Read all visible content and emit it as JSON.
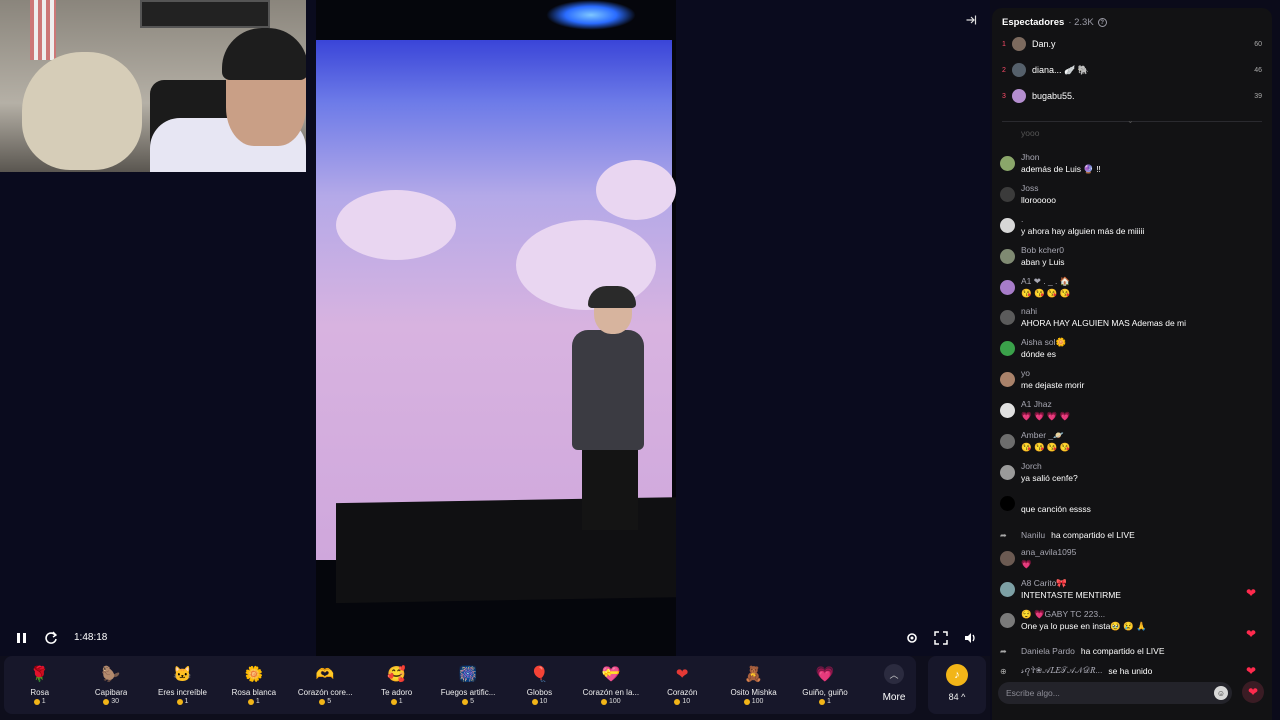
{
  "playback": {
    "time": "1:48:18"
  },
  "gifts": [
    {
      "name": "Rosa",
      "price": "1",
      "icon": "rose-icon",
      "glyph": "🌹",
      "color": "#d81b60"
    },
    {
      "name": "Capibara",
      "price": "30",
      "icon": "capybara-icon",
      "glyph": "🦫",
      "color": "#b5723a"
    },
    {
      "name": "Eres increíble",
      "price": "1",
      "icon": "cat-icon",
      "glyph": "🐱",
      "color": "#f2c27b"
    },
    {
      "name": "Rosa blanca",
      "price": "1",
      "icon": "white-rose-icon",
      "glyph": "🌼",
      "color": "#f5f2e8"
    },
    {
      "name": "Corazón core...",
      "price": "5",
      "icon": "heart-hand-icon",
      "glyph": "🫶",
      "color": "#f4a57c"
    },
    {
      "name": "Te adoro",
      "price": "1",
      "icon": "heart-face-icon",
      "glyph": "🥰",
      "color": "#e53935"
    },
    {
      "name": "Fuegos artific...",
      "price": "5",
      "icon": "fireworks-icon",
      "glyph": "🎆",
      "color": "#7e57c2"
    },
    {
      "name": "Globos",
      "price": "10",
      "icon": "balloons-icon",
      "glyph": "🎈",
      "color": "#90caf9"
    },
    {
      "name": "Corazón en la...",
      "price": "100",
      "icon": "heart-box-icon",
      "glyph": "💝",
      "color": "#f06292"
    },
    {
      "name": "Corazón",
      "price": "10",
      "icon": "heart-icon",
      "glyph": "❤",
      "color": "#e53935"
    },
    {
      "name": "Osito Mishka",
      "price": "100",
      "icon": "bear-icon",
      "glyph": "🧸",
      "color": "#8d5a3b"
    },
    {
      "name": "Guiño, guiño",
      "price": "1",
      "icon": "wink-heart-icon",
      "glyph": "💗",
      "color": "#f48fb1"
    }
  ],
  "gift_more": {
    "label": "More"
  },
  "balance": {
    "value": "84 ^",
    "glyph": "♪"
  },
  "viewers": {
    "title": "Espectadores",
    "count": "· 2.3K",
    "top": [
      {
        "rank": "1",
        "name": "Dan.y",
        "score": "60",
        "avatar_color": "#7c6a5e"
      },
      {
        "rank": "2",
        "name": "diana... 🪽 🐘",
        "score": "46",
        "avatar_color": "#55606b"
      },
      {
        "rank": "3",
        "name": "bugabu55.",
        "score": "39",
        "avatar_color": "#b48ecf"
      }
    ]
  },
  "chat": {
    "faded_name": "yooo",
    "messages": [
      {
        "name": "Jhon",
        "text": "además de Luis 🔮 ‼",
        "avatar_color": "#8aa66a"
      },
      {
        "name": "Joss",
        "text": "llorooooo",
        "avatar_color": "#3b3b3b"
      },
      {
        "name": ".",
        "text": "y ahora hay alguien más de miiiii",
        "avatar_color": "#d7d7d7"
      },
      {
        "name": "Bob kcher0",
        "text": "aban y Luis",
        "avatar_color": "#7f8a72"
      },
      {
        "name": "A1 ❤ . _ . 🏠",
        "text": "😘 😘 😘 😘",
        "avatar_color": "#a77cc9"
      },
      {
        "name": "nahi",
        "text": "AHORA HAY ALGUIEN MAS Ademas de mi",
        "avatar_color": "#5b5b5b"
      },
      {
        "name": "Aisha sol🌼",
        "text": "dónde es",
        "avatar_color": "#3aa14a"
      },
      {
        "name": "yo",
        "text": "me dejaste morir",
        "avatar_color": "#a9826a"
      },
      {
        "name": "A1 Jhaz",
        "text": "💗 💗 💗 💗",
        "avatar_color": "#e0e0e0"
      },
      {
        "name": "Amber _🪐",
        "text": "😘 😘 😘 😘",
        "avatar_color": "#6d6d6d"
      },
      {
        "name": "Jorch",
        "text": "ya salió cenfe?",
        "avatar_color": "#9a9a9a"
      },
      {
        "name": "",
        "text": "que canción essss",
        "avatar_color": "#000000"
      }
    ],
    "system_1": {
      "name": "Nanilu",
      "text": "ha compartido el LIVE"
    },
    "messages_2": [
      {
        "name": "ana_avila1095",
        "text": "💗",
        "avatar_color": "#6b5a52"
      },
      {
        "name": "A8 Carito🎀",
        "text": "INTENTASTE MENTIRME",
        "avatar_color": "#7da0a5"
      },
      {
        "name": "😌 💗GABY TC 223...",
        "text": "One ya lo puse en insta🥹 😢 🙏",
        "avatar_color": "#7a7a7a"
      }
    ],
    "system_2": {
      "name": "Daniela Pardo",
      "text": "ha compartido el LIVE"
    },
    "system_3": {
      "name": "𝓈ꪖ✞❀𝒜𝐿𝐸𝒯𝒜𝒩𝒟𝑅...",
      "text": "se ha unido"
    }
  },
  "input": {
    "placeholder": "Escribe algo..."
  }
}
